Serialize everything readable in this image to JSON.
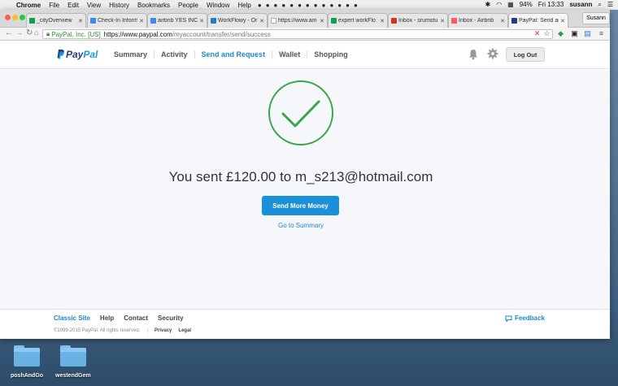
{
  "menubar": {
    "app": "Chrome",
    "items": [
      "File",
      "Edit",
      "View",
      "History",
      "Bookmarks",
      "People",
      "Window",
      "Help"
    ],
    "battery": "94%",
    "clock": "Fri 13:33",
    "user": "susann"
  },
  "browser": {
    "tabs": [
      {
        "label": "_cityOverview",
        "favicon_color": "#0f9d58"
      },
      {
        "label": "Check-In Inform",
        "favicon_color": "#4285f4"
      },
      {
        "label": "airbnb YES INC",
        "favicon_color": "#4285f4"
      },
      {
        "label": "WorkFlowy - Or",
        "favicon_color": "#2a7abf"
      },
      {
        "label": "https://www.am",
        "favicon_color": "#cccccc"
      },
      {
        "label": "expert workFlo",
        "favicon_color": "#0f9d58"
      },
      {
        "label": "Inbox - srumstu",
        "favicon_color": "#d93025"
      },
      {
        "label": "Inbox - Airbnb",
        "favicon_color": "#ff5a5f"
      },
      {
        "label": "PayPal: Send an",
        "favicon_color": "#253b80",
        "active": true
      }
    ],
    "profile": "Susann",
    "url": {
      "ev_label": "PayPal, Inc. [US]",
      "host": "https://www.paypal.com",
      "path": "/myaccount/transfer/send/success"
    }
  },
  "paypal": {
    "logo": {
      "part1": "Pay",
      "part2": "Pal"
    },
    "nav": [
      {
        "label": "Summary",
        "active": false
      },
      {
        "label": "Activity",
        "active": false
      },
      {
        "label": "Send and Request",
        "active": true
      },
      {
        "label": "Wallet",
        "active": false
      },
      {
        "label": "Shopping",
        "active": false
      }
    ],
    "logout": "Log Out",
    "success_message": "You sent £120.00 to m_s213@hotmail.com",
    "send_more": "Send More Money",
    "go_to_summary": "Go to Summary",
    "footer": {
      "links": [
        "Classic Site",
        "Help",
        "Contact",
        "Security"
      ],
      "feedback": "Feedback",
      "copyright": "©1999-2015 PayPal. All rights reserved.",
      "privacy": "Privacy",
      "legal": "Legal"
    }
  },
  "desktop": {
    "folders": [
      "poshAndGo",
      "westendGem"
    ]
  },
  "colors": {
    "accent": "#1b8bd3",
    "success": "#3aa54a",
    "button": "#1a90d9"
  }
}
